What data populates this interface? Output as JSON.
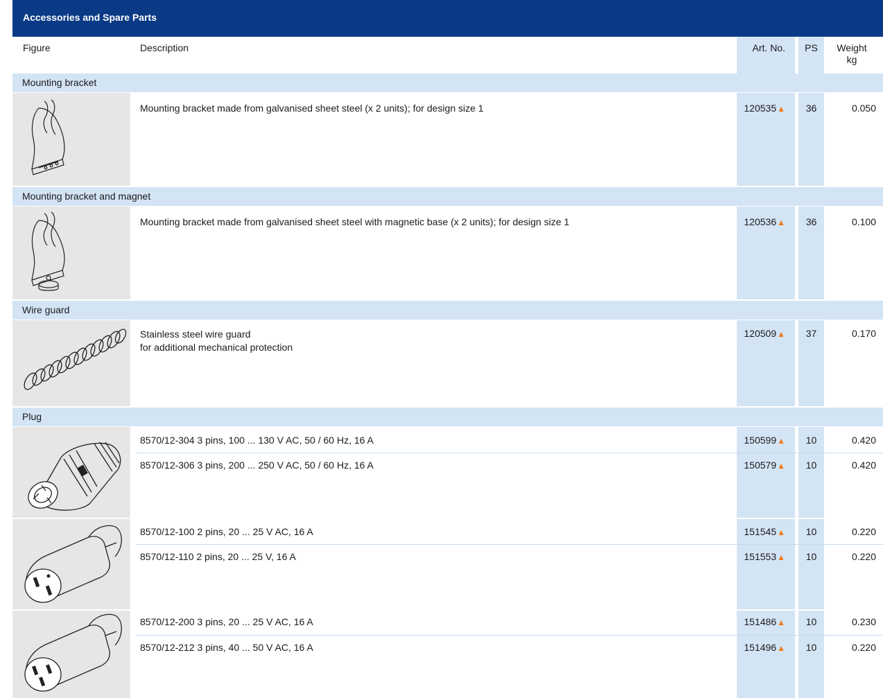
{
  "banner_title": "Accessories and Spare Parts",
  "columns": {
    "figure": "Figure",
    "description": "Description",
    "art_no": "Art. No.",
    "ps": "PS",
    "weight_line1": "Weight",
    "weight_line2": "kg"
  },
  "availability_marker": "▲",
  "colors": {
    "header_blue": "#0a3a86",
    "light_blue": "#d3e4f5",
    "figure_grey": "#e6e6e6",
    "marker_orange": "#ef7a1a"
  },
  "sections": [
    {
      "title": "Mounting bracket",
      "figure_icon": "mounting-bracket",
      "rows": [
        {
          "lines": [
            "Mounting bracket made from galvanised sheet steel (x 2 units); for design size 1"
          ],
          "art_no": "120535",
          "ps": "36",
          "weight": "0.050"
        }
      ]
    },
    {
      "title": "Mounting bracket and magnet",
      "figure_icon": "mounting-bracket-magnet",
      "rows": [
        {
          "lines": [
            "Mounting bracket made from galvanised sheet steel with magnetic base (x 2 units); for design size 1"
          ],
          "art_no": "120536",
          "ps": "36",
          "weight": "0.100"
        }
      ]
    },
    {
      "title": "Wire guard",
      "figure_icon": "wire-guard-spring",
      "rows": [
        {
          "lines": [
            "Stainless steel wire guard",
            "for additional mechanical protection"
          ],
          "art_no": "120509",
          "ps": "37",
          "weight": "0.170"
        }
      ]
    },
    {
      "title": "Plug",
      "groups": [
        {
          "figure_icon": "industrial-plug",
          "rows": [
            {
              "lines": [
                "8570/12-304 3 pins, 100 ... 130 V AC, 50 / 60 Hz, 16 A"
              ],
              "art_no": "150599",
              "ps": "10",
              "weight": "0.420"
            },
            {
              "lines": [
                "8570/12-306 3 pins, 200 ... 250 V AC, 50 / 60 Hz, 16 A"
              ],
              "art_no": "150579",
              "ps": "10",
              "weight": "0.420"
            }
          ]
        },
        {
          "figure_icon": "plug-2-pin",
          "rows": [
            {
              "lines": [
                "8570/12-100 2 pins, 20 ... 25 V AC, 16 A"
              ],
              "art_no": "151545",
              "ps": "10",
              "weight": "0.220"
            },
            {
              "lines": [
                "8570/12-110 2 pins, 20 ... 25 V, 16 A"
              ],
              "art_no": "151553",
              "ps": "10",
              "weight": "0.220"
            }
          ]
        },
        {
          "figure_icon": "plug-3-pin",
          "rows": [
            {
              "lines": [
                "8570/12-200 3 pins, 20 ... 25 V AC, 16 A"
              ],
              "art_no": "151486",
              "ps": "10",
              "weight": "0.230"
            },
            {
              "lines": [
                "8570/12-212 3 pins, 40 ... 50 V AC, 16 A"
              ],
              "art_no": "151496",
              "ps": "10",
              "weight": "0.220"
            }
          ]
        }
      ]
    }
  ]
}
